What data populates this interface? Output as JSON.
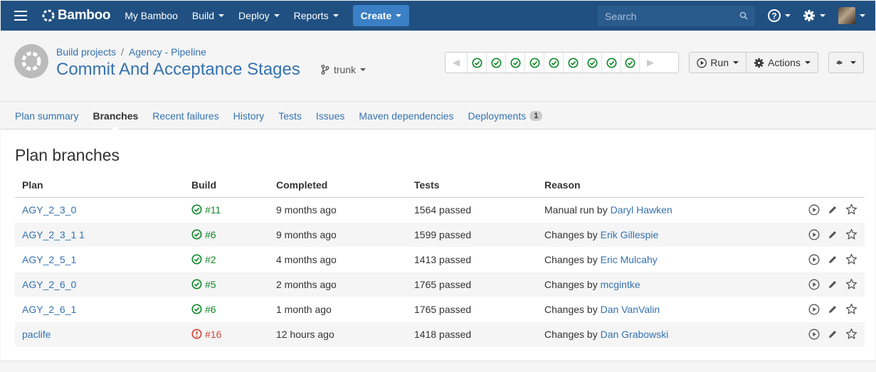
{
  "nav": {
    "brand": "Bamboo",
    "items": [
      {
        "label": "My Bamboo",
        "caret": false
      },
      {
        "label": "Build",
        "caret": true
      },
      {
        "label": "Deploy",
        "caret": true
      },
      {
        "label": "Reports",
        "caret": true
      }
    ],
    "create_label": "Create",
    "search_placeholder": "Search"
  },
  "header": {
    "breadcrumb": [
      "Build projects",
      "Agency - Pipeline"
    ],
    "title": "Commit And Acceptance Stages",
    "branch": "trunk",
    "recent_builds": [
      "success",
      "success",
      "success",
      "success",
      "success",
      "success",
      "success",
      "success",
      "success"
    ],
    "run_label": "Run",
    "actions_label": "Actions"
  },
  "tabs": [
    {
      "label": "Plan summary",
      "active": false
    },
    {
      "label": "Branches",
      "active": true
    },
    {
      "label": "Recent failures",
      "active": false
    },
    {
      "label": "History",
      "active": false
    },
    {
      "label": "Tests",
      "active": false
    },
    {
      "label": "Issues",
      "active": false
    },
    {
      "label": "Maven dependencies",
      "active": false
    },
    {
      "label": "Deployments",
      "active": false,
      "badge": "1"
    }
  ],
  "branches": {
    "title": "Plan branches",
    "columns": [
      "Plan",
      "Build",
      "Completed",
      "Tests",
      "Reason"
    ],
    "rows": [
      {
        "plan": "AGY_2_3_0",
        "build": "#11",
        "status": "success",
        "completed": "9 months ago",
        "tests": "1564 passed",
        "reason_prefix": "Manual run by",
        "user": "Daryl Hawken"
      },
      {
        "plan": "AGY_2_3_1 1",
        "build": "#6",
        "status": "success",
        "completed": "9 months ago",
        "tests": "1599 passed",
        "reason_prefix": "Changes by",
        "user": "Erik Gillespie"
      },
      {
        "plan": "AGY_2_5_1",
        "build": "#2",
        "status": "success",
        "completed": "4 months ago",
        "tests": "1413 passed",
        "reason_prefix": "Changes by",
        "user": "Eric Mulcahy"
      },
      {
        "plan": "AGY_2_6_0",
        "build": "#5",
        "status": "success",
        "completed": "2 months ago",
        "tests": "1765 passed",
        "reason_prefix": "Changes by",
        "user": "mcgintke"
      },
      {
        "plan": "AGY_2_6_1",
        "build": "#6",
        "status": "success",
        "completed": "1 month ago",
        "tests": "1765 passed",
        "reason_prefix": "Changes by",
        "user": "Dan VanValin"
      },
      {
        "plan": "paclife",
        "build": "#16",
        "status": "failed",
        "completed": "12 hours ago",
        "tests": "1418 passed",
        "reason_prefix": "Changes by",
        "user": "Dan Grabowski"
      }
    ]
  },
  "colors": {
    "nav_bg": "#205081",
    "link": "#3572b0",
    "success": "#14892c",
    "failed": "#d04437"
  }
}
